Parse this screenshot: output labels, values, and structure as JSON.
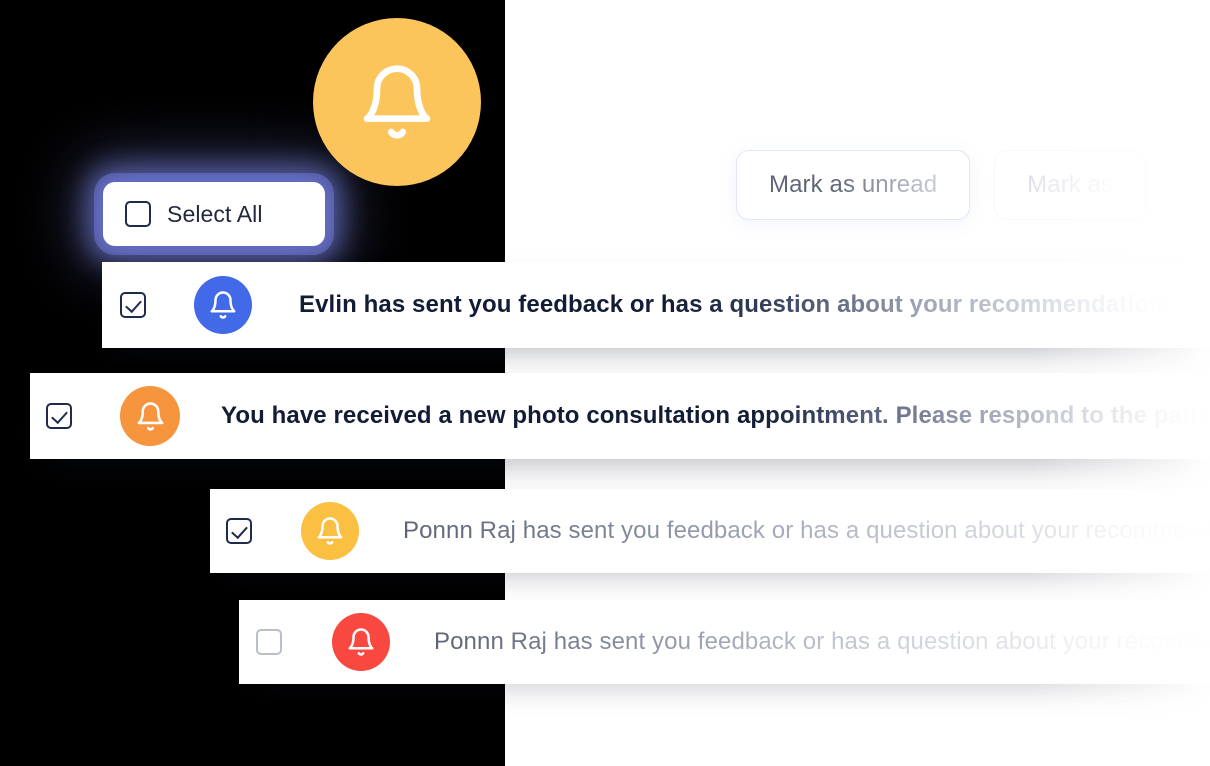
{
  "panel": {
    "background_color": "#000000"
  },
  "hero": {
    "icon": "bell-icon",
    "circle_color": "#FBC55C"
  },
  "toolbar": {
    "buttons": [
      {
        "label": "Mark as unread",
        "state": "enabled"
      },
      {
        "label": "Mark as",
        "state": "faded"
      }
    ]
  },
  "select_all": {
    "label": "Select All",
    "checked": false,
    "highlighted": true,
    "glow_color": "#828CFC"
  },
  "notifications": [
    {
      "id": "row1",
      "checked": true,
      "read": false,
      "icon": "bell-icon",
      "icon_color": "#4169E8",
      "text": "Evlin has sent you feedback or has a question about your recommendations"
    },
    {
      "id": "row2",
      "checked": true,
      "read": false,
      "icon": "bell-icon",
      "icon_color": "#F7943E",
      "text": "You have received a new photo consultation appointment. Please respond to the patient"
    },
    {
      "id": "row3",
      "checked": true,
      "read": true,
      "icon": "bell-icon",
      "icon_color": "#FBBF41",
      "text": "Ponnn Raj has sent you feedback or has a question about your recommendations"
    },
    {
      "id": "row4",
      "checked": false,
      "read": true,
      "icon": "bell-icon",
      "icon_color": "#F8483F",
      "text": "Ponnn Raj has sent you feedback or has a question about your recommendations"
    }
  ],
  "colors": {
    "checkbox_border_active": "#1F2B4D",
    "checkbox_border_inactive": "#B9BECD",
    "text_unread": "#131C35",
    "text_read": "#5C6476",
    "button_border": "#E4E7F4",
    "card_background": "#FFFFFF"
  }
}
